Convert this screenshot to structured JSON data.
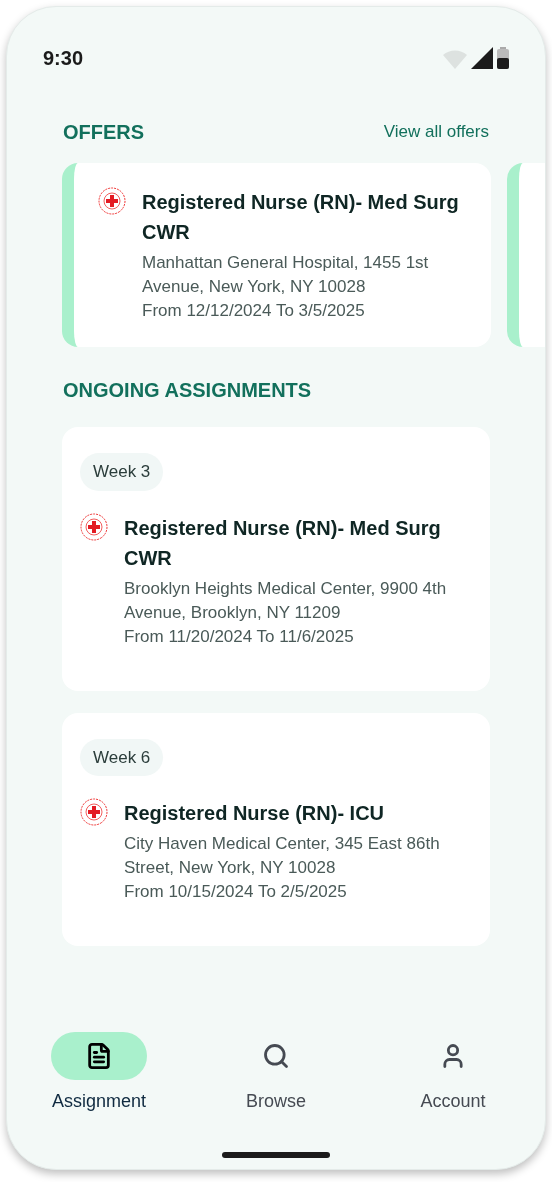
{
  "status_bar": {
    "time": "9:30"
  },
  "offers": {
    "title": "OFFERS",
    "link": "View all offers",
    "cards": [
      {
        "title": "Registered Nurse (RN)- Med Surg CWR",
        "address": "Manhattan General Hospital, 1455 1st Avenue, New York, NY 10028",
        "dates": "From 12/12/2024 To 3/5/2025"
      }
    ]
  },
  "ongoing": {
    "title": "ONGOING ASSIGNMENTS",
    "cards": [
      {
        "week": "Week 3",
        "title": "Registered Nurse (RN)- Med Surg CWR",
        "address": "Brooklyn Heights Medical Center, 9900 4th Avenue, Brooklyn, NY 11209",
        "dates": "From 11/20/2024 To 11/6/2025"
      },
      {
        "week": "Week 6",
        "title": "Registered Nurse (RN)- ICU",
        "address": "City Haven Medical Center, 345 East 86th Street, New York, NY 10028",
        "dates": "From 10/15/2024 To 2/5/2025"
      }
    ]
  },
  "nav": [
    {
      "kind": "document",
      "label": "Assignment",
      "selected": true
    },
    {
      "kind": "search",
      "label": "Browse",
      "selected": false
    },
    {
      "kind": "person",
      "label": "Account",
      "selected": false
    }
  ]
}
